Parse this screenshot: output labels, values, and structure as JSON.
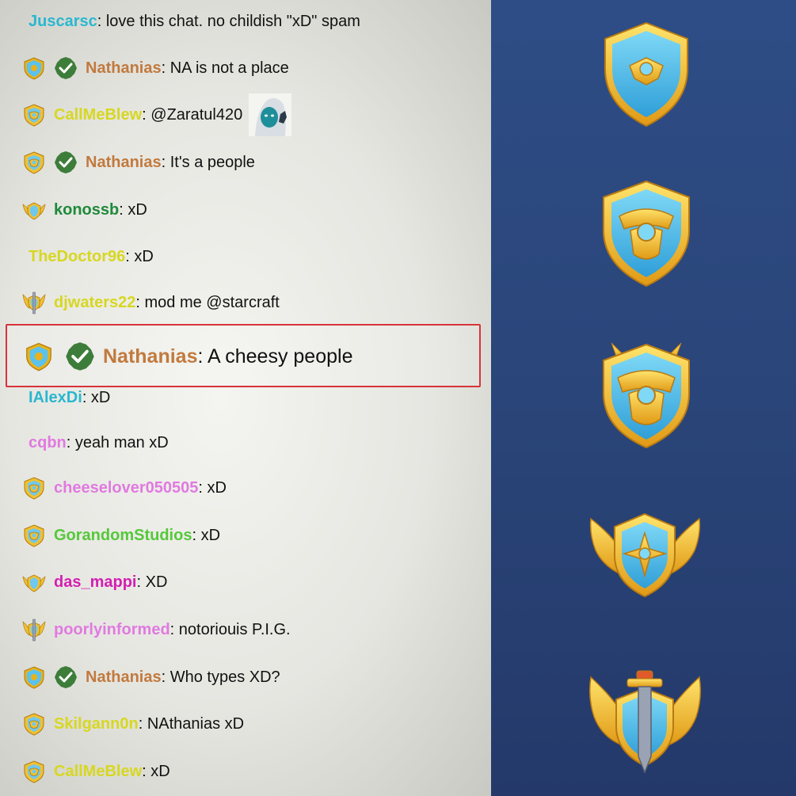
{
  "colors": {
    "nathanias": "#c17a3e",
    "cyan": "#2ab7cf",
    "yellow": "#d7d721",
    "green": "#1e8a3a",
    "lime": "#55c83a",
    "pink": "#e07ae0",
    "magenta": "#d31fb0",
    "mod_green": "#3d7d3a",
    "highlight_border": "#d8333a",
    "badge_panel": "#2e4d86"
  },
  "messages": [
    {
      "badge": "none",
      "mod": false,
      "name": "Juscarsc",
      "color": "#2ab7cf",
      "text": ": love this chat. no childish \"xD\" spam"
    },
    {
      "badge": "shield-small",
      "mod": true,
      "name": "Nathanias",
      "color": "#c17a3e",
      "text": ": NA is not a place"
    },
    {
      "badge": "shield-gold",
      "mod": false,
      "name": "CallMeBlew",
      "color": "#d7d721",
      "text": ": @Zaratul420",
      "emote": "waving-face-emote"
    },
    {
      "badge": "shield-gold",
      "mod": true,
      "name": "Nathanias",
      "color": "#c17a3e",
      "text": ": It's a people"
    },
    {
      "badge": "winged",
      "mod": false,
      "name": "konossb",
      "color": "#1e8a3a",
      "text": ": xD"
    },
    {
      "badge": "none",
      "mod": false,
      "name": "TheDoctor96",
      "color": "#d7d721",
      "text": ": xD"
    },
    {
      "badge": "winged-sword",
      "mod": false,
      "name": "djwaters22",
      "color": "#d7d721",
      "text": ": mod me @starcraft"
    },
    {
      "badge": "shield-small",
      "mod": true,
      "name": "Nathanias",
      "color": "#c17a3e",
      "text": ": A cheesy people",
      "big": true
    },
    {
      "badge": "none",
      "mod": false,
      "name": "IAlexDi",
      "color": "#2ab7cf",
      "text": ": xD"
    },
    {
      "badge": "none",
      "mod": false,
      "name": "cqbn",
      "color": "#e07ae0",
      "text": ": yeah man xD"
    },
    {
      "badge": "shield-gold",
      "mod": false,
      "name": "cheeselover050505",
      "color": "#e07ae0",
      "text": ": xD"
    },
    {
      "badge": "shield-gold",
      "mod": false,
      "name": "GorandomStudios",
      "color": "#55c83a",
      "text": ": xD"
    },
    {
      "badge": "winged",
      "mod": false,
      "name": "das_mappi",
      "color": "#d31fb0",
      "text": ": XD"
    },
    {
      "badge": "winged-sword",
      "mod": false,
      "name": "poorlyinformed",
      "color": "#e07ae0",
      "text": ": notoriouis P.I.G."
    },
    {
      "badge": "shield-small",
      "mod": true,
      "name": "Nathanias",
      "color": "#c17a3e",
      "text": ": Who types XD?"
    },
    {
      "badge": "shield-gold",
      "mod": false,
      "name": "Skilgann0n",
      "color": "#d7d721",
      "text": ": NAthanias xD"
    },
    {
      "badge": "shield-gold",
      "mod": false,
      "name": "CallMeBlew",
      "color": "#d7d721",
      "text": ": xD"
    }
  ],
  "rank_badges": [
    {
      "icon": "rank-shield-1-icon"
    },
    {
      "icon": "rank-shield-2-icon"
    },
    {
      "icon": "rank-shield-3-icon"
    },
    {
      "icon": "rank-winged-shield-icon"
    },
    {
      "icon": "rank-winged-sword-icon"
    }
  ]
}
